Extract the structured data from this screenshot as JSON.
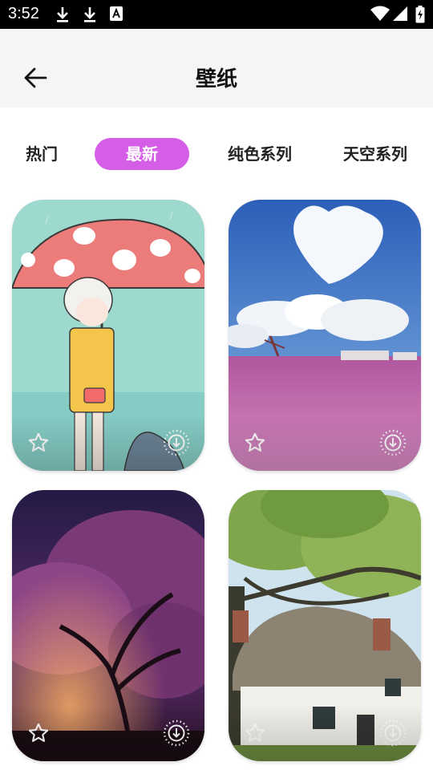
{
  "status_bar": {
    "time": "3:52",
    "icons": [
      "download-icon",
      "download-icon",
      "font-a-icon",
      "wifi-icon",
      "signal-icon",
      "battery-charging-icon"
    ]
  },
  "app_bar": {
    "title": "壁纸",
    "back_icon": "arrow-left-icon"
  },
  "tabs": [
    {
      "label": "热门",
      "active": false
    },
    {
      "label": "最新",
      "active": true
    },
    {
      "label": "纯色系列",
      "active": false
    },
    {
      "label": "天空系列",
      "active": false
    }
  ],
  "accent_color": "#d45ee5",
  "wallpapers": [
    {
      "subject": "girl-with-mushroom-umbrella",
      "icons": [
        "star-outline-icon",
        "apply-wallpaper-icon"
      ]
    },
    {
      "subject": "heart-cloud-pink-field",
      "icons": [
        "star-outline-icon",
        "apply-wallpaper-icon"
      ]
    },
    {
      "subject": "purple-blossom-tree-night",
      "icons": [
        "star-outline-icon",
        "apply-wallpaper-icon"
      ]
    },
    {
      "subject": "thatched-cottage-under-tree",
      "icons": [
        "star-outline-icon",
        "apply-wallpaper-icon"
      ]
    }
  ]
}
